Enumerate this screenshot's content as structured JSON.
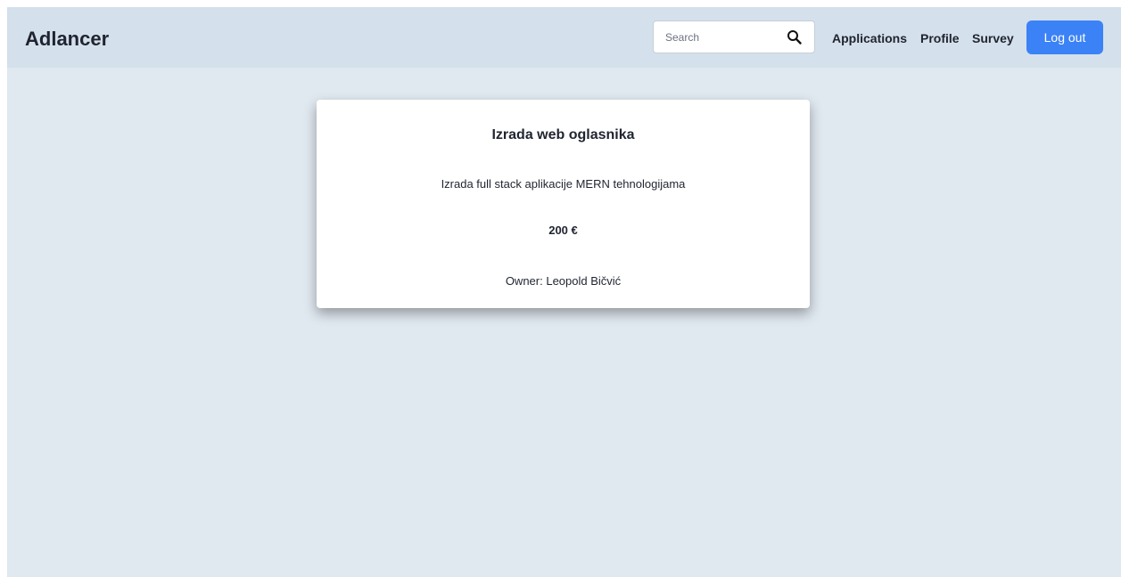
{
  "navbar": {
    "brand": "Adlancer",
    "search": {
      "placeholder": "Search",
      "value": "",
      "icon": "search-icon"
    },
    "links": [
      {
        "label": "Applications"
      },
      {
        "label": "Profile"
      },
      {
        "label": "Survey"
      }
    ],
    "logout_label": "Log out"
  },
  "card": {
    "title": "Izrada web oglasnika",
    "description": "Izrada full stack aplikacije MERN tehnologijama",
    "price": "200 €",
    "owner_label": "Owner:",
    "owner_name": "Leopold Bičvić"
  },
  "colors": {
    "page_background": "#e0e8f0",
    "navbar_background": "#d4e0eb",
    "accent": "#3b82f6",
    "card_background": "#ffffff",
    "text": "#1f2430"
  }
}
